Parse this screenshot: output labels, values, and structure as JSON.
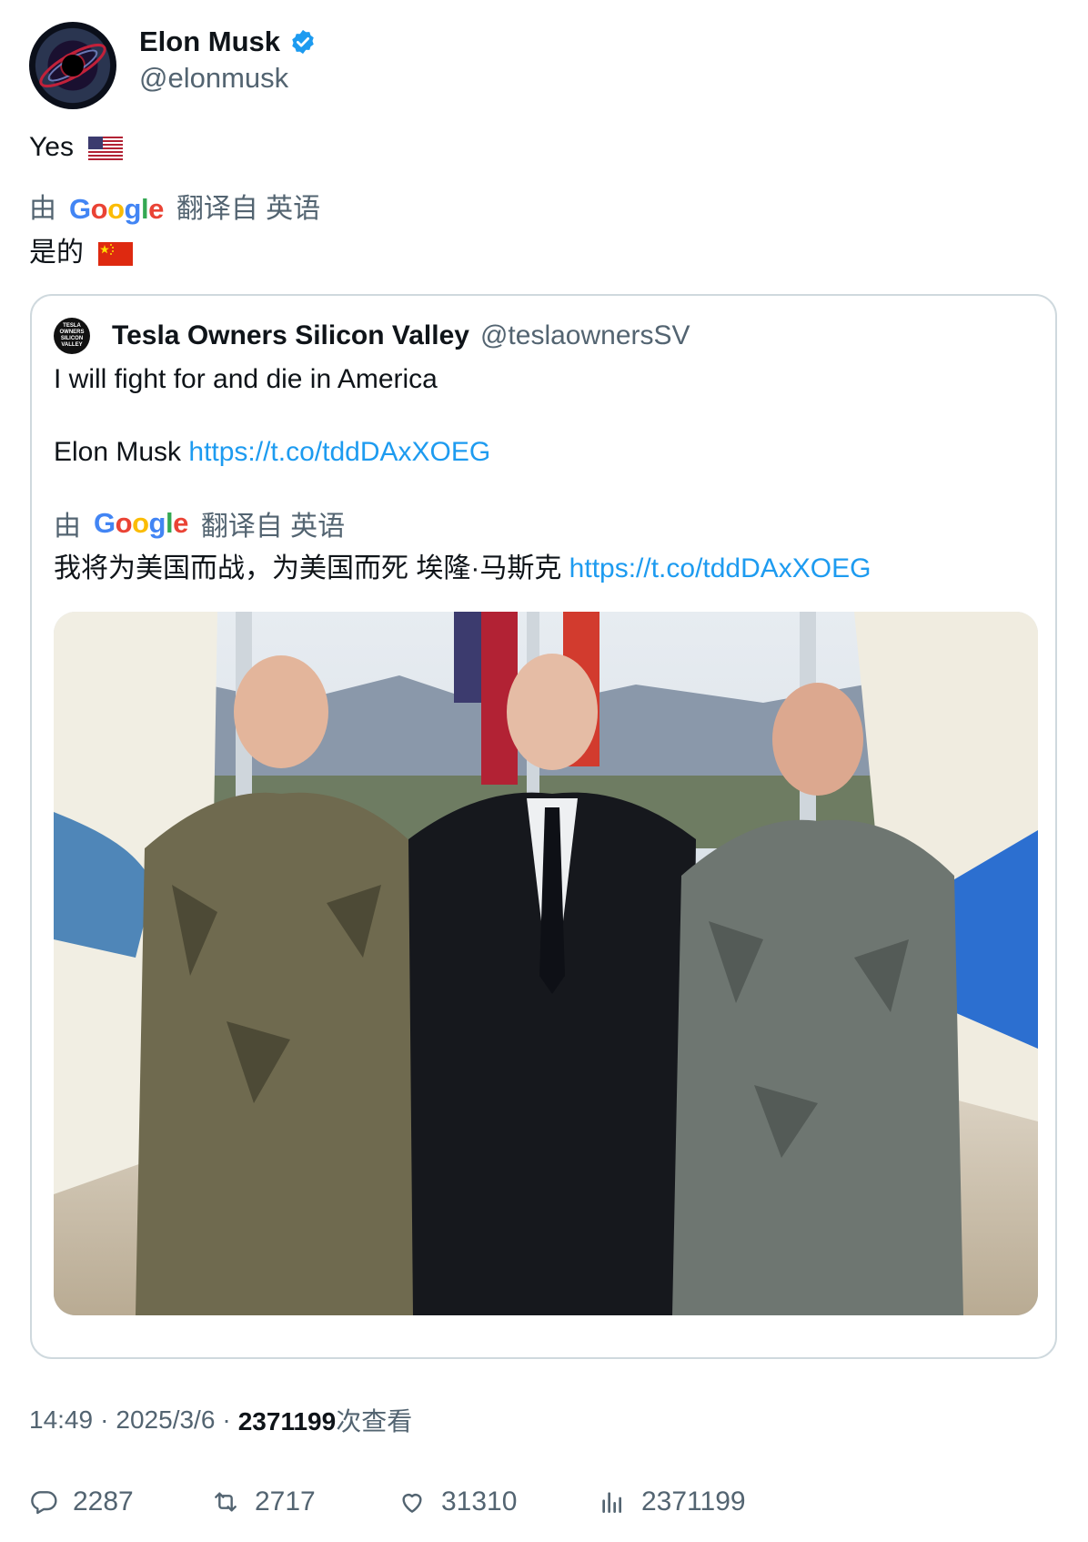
{
  "author": {
    "name": "Elon Musk",
    "handle": "@elonmusk",
    "verified": true
  },
  "tweet": {
    "text": "Yes",
    "flag_icon": "us-flag-icon"
  },
  "translation": {
    "by": "由",
    "provider": "Google",
    "from": "翻译自 英语",
    "text": "是的",
    "flag_icon": "china-flag-icon"
  },
  "quote": {
    "avatar_text": "TESLA OWNERS SILICON VALLEY",
    "name": "Tesla Owners Silicon Valley",
    "handle": "@teslaownersSV",
    "line1": "I will fight for and die in America",
    "line2_prefix": "Elon Musk ",
    "link": "https://t.co/tddDAxXOEG",
    "translation": {
      "by": "由",
      "provider": "Google",
      "from": "翻译自 英语",
      "text": "我将为美国而战，为美国而死 埃隆·马斯克 ",
      "link": "https://t.co/tddDAxXOEG"
    },
    "media_icon": "photo-three-men-icon"
  },
  "meta": {
    "time": "14:49",
    "sep1": "·",
    "date": "2025/3/6",
    "sep2": "·",
    "views": "2371199",
    "views_label": "次查看"
  },
  "actions": {
    "replies": "2287",
    "reposts": "2717",
    "likes": "31310",
    "views": "2371199"
  },
  "colors": {
    "link": "#1d9bf0",
    "muted": "#536471",
    "verified": "#1d9bf0",
    "border": "#cfd9de"
  }
}
